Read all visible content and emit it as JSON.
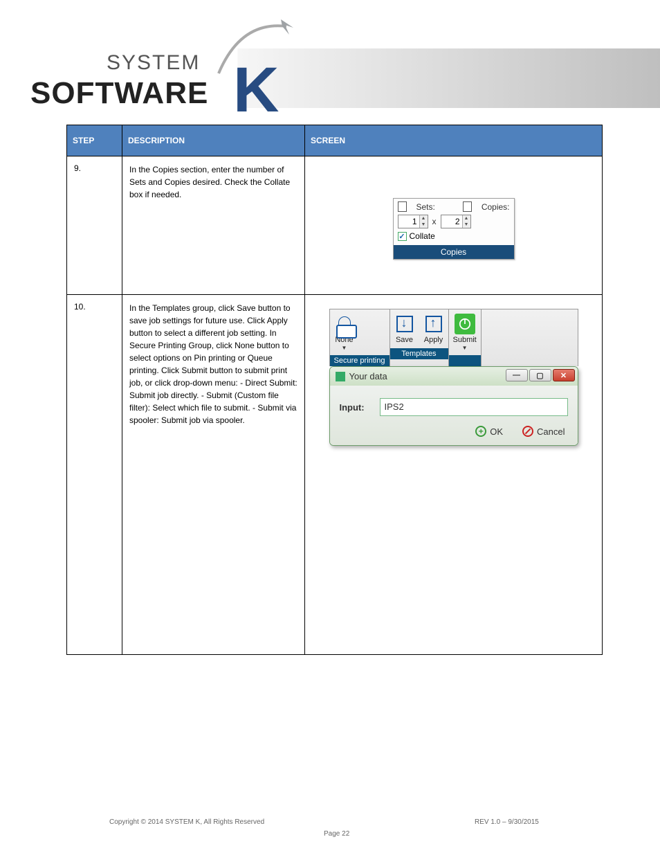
{
  "logo": {
    "system": "SYSTEM",
    "software": "SOFTWARE"
  },
  "table": {
    "headers": {
      "c1": "STEP",
      "c2": "DESCRIPTION",
      "c3": "SCREEN"
    },
    "rows": [
      {
        "step": "9.",
        "desc": "In the Copies section, enter the number of Sets and Copies desired.\n\nCheck the Collate box if needed."
      },
      {
        "step": "10.",
        "desc": "In the Templates group, click Save button to save job settings for future use. Click Apply button to select a different job setting.\n\nIn Secure Printing Group, click None button to select options on Pin printing or Queue printing.\n\nClick Submit button to submit print job, or click drop-down menu:\n- Direct Submit: Submit job directly.\n- Submit (Custom file filter): Select which file to submit.\n- Submit via spooler: Submit job via spooler."
      }
    ]
  },
  "copies": {
    "sets_label": "Sets:",
    "copies_label": "Copies:",
    "sets_value": "1",
    "copies_value": "2",
    "mult": "x",
    "collate_label": "Collate",
    "footer": "Copies"
  },
  "ribbon": {
    "secure_group": "Secure printing",
    "templates_group": "Templates",
    "none": "None",
    "save": "Save",
    "apply": "Apply",
    "submit": "Submit"
  },
  "dialog": {
    "title": "Your data",
    "input_label": "Input:",
    "input_value": "IPS2",
    "ok": "OK",
    "cancel": "Cancel"
  },
  "footer": {
    "copyright": "Copyright © 2014 SYSTEM K, All Rights Reserved",
    "revision": "REV 1.0 – 9/30/2015",
    "page": "Page 22"
  }
}
